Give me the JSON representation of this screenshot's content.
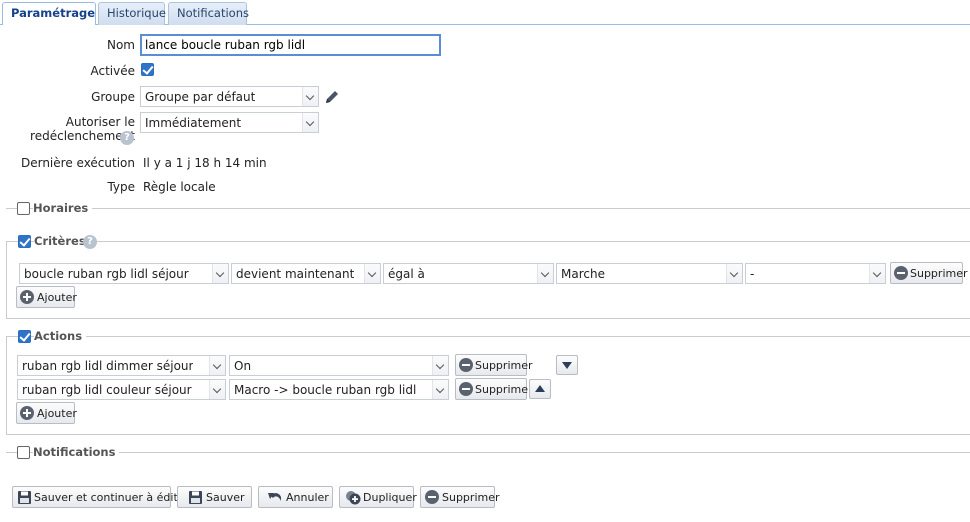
{
  "tabs": [
    {
      "label": "Paramétrage",
      "active": true
    },
    {
      "label": "Historique",
      "active": false
    },
    {
      "label": "Notifications",
      "active": false
    }
  ],
  "form": {
    "nom_label": "Nom",
    "nom_value": "lance boucle ruban rgb lidl",
    "activee_label": "Activée",
    "activee_checked": true,
    "groupe_label": "Groupe",
    "groupe_value": "Groupe par défaut",
    "autoriser_label_1": "Autoriser le",
    "autoriser_label_2": "redéclenchement",
    "autoriser_value": "Immédiatement",
    "derniere_label": "Dernière exécution",
    "derniere_value": "Il y a 1 j 18 h 14 min",
    "type_label": "Type",
    "type_value": "Règle locale"
  },
  "horaires": {
    "title": "Horaires",
    "checked": false
  },
  "criteres": {
    "title": "Critères",
    "checked": true,
    "row": {
      "device": "boucle ruban rgb lidl séjour",
      "condition": "devient maintenant",
      "operator": "égal à",
      "value": "Marche",
      "extra": "-",
      "delete_label": "Supprimer"
    },
    "add_label": "Ajouter"
  },
  "actions": {
    "title": "Actions",
    "checked": true,
    "rows": [
      {
        "device": "ruban rgb lidl dimmer séjour",
        "action": "On",
        "delete_label": "Supprimer"
      },
      {
        "device": "ruban rgb lidl couleur séjour",
        "action": "Macro -> boucle ruban rgb lidl",
        "delete_label": "Supprimer"
      }
    ],
    "add_label": "Ajouter"
  },
  "notifications": {
    "title": "Notifications",
    "checked": false
  },
  "footer": {
    "save_continue": "Sauver et continuer à éditer",
    "save": "Sauver",
    "cancel": "Annuler",
    "duplicate": "Dupliquer",
    "delete": "Supprimer"
  },
  "colors": {
    "accent": "#2f74c8",
    "tab_text": "#15428b"
  }
}
